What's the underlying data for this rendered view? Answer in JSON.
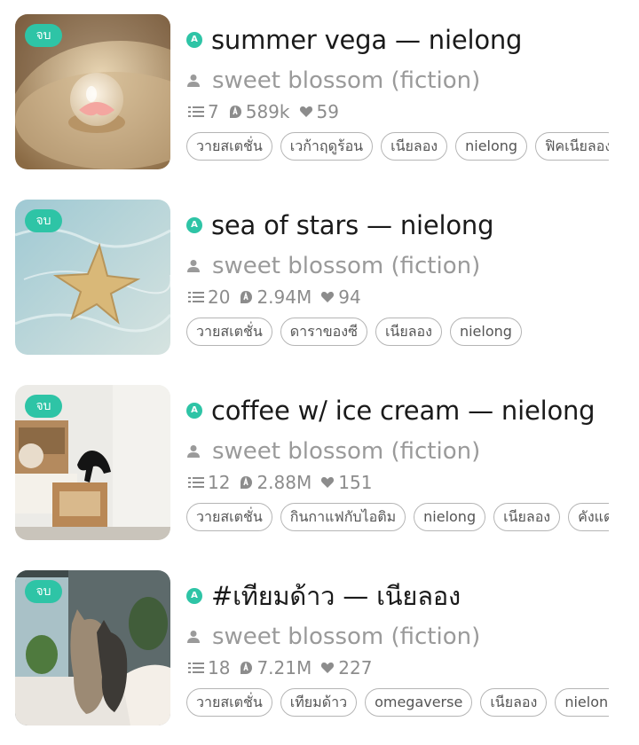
{
  "badge_label": "จบ",
  "stories": [
    {
      "title": "summer vega — nielong",
      "author": "sweet blossom (fiction)",
      "chapters": "7",
      "views": "589k",
      "likes": "59",
      "tags": [
        "วายสเตชั่น",
        "เวก้าฤดูร้อน",
        "เนียลอง",
        "nielong",
        "ฟิคเนียลอง"
      ]
    },
    {
      "title": "sea of stars — nielong",
      "author": "sweet blossom (fiction)",
      "chapters": "20",
      "views": "2.94M",
      "likes": "94",
      "tags": [
        "วายสเตชั่น",
        "ดาราของซี",
        "เนียลอง",
        "nielong"
      ]
    },
    {
      "title": "coffee w/ ice cream — nielong",
      "author": "sweet blossom (fiction)",
      "chapters": "12",
      "views": "2.88M",
      "likes": "151",
      "tags": [
        "วายสเตชั่น",
        "กินกาแฟกับไอติม",
        "nielong",
        "เนียลอง",
        "คังแด"
      ]
    },
    {
      "title": "#เทียมด้าว — เนียลอง",
      "author": "sweet blossom (fiction)",
      "chapters": "18",
      "views": "7.21M",
      "likes": "227",
      "tags": [
        "วายสเตชั่น",
        "เทียมด้าว",
        "omegaverse",
        "เนียลอง",
        "nielong"
      ]
    }
  ],
  "colors": {
    "accent": "#2ec4a6",
    "title": "#1a1a1a",
    "author": "#9a9a9a",
    "stats": "#8c8c8c",
    "chip_border": "#b5b5b5"
  },
  "icons": {
    "title_marker": "teal-a-circle-icon",
    "author": "person-icon",
    "chapters": "list-icon",
    "views": "eye-drop-icon",
    "likes": "heart-icon"
  }
}
